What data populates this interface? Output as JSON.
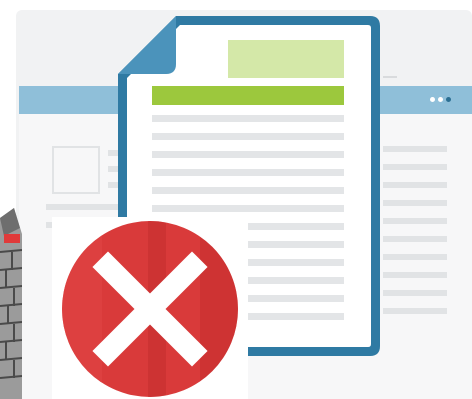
{
  "illustration": {
    "subject": "document-with-error",
    "icons": {
      "document": "document-icon",
      "error": "error-x-icon",
      "wall": "brick-wall-icon",
      "window_menu": "more-dots-icon"
    },
    "colors": {
      "window_background": "#f1f2f3",
      "title_bar": "#8fbfd9",
      "document_border": "#2f7aa3",
      "document_fold": "#4b93bb",
      "document_paper": "#ffffff",
      "document_lines": "#e3e5e7",
      "highlight_light_green": "#d4e8a8",
      "highlight_green": "#9cc83d",
      "error_red": "#d93a3a",
      "error_red_dark": "#c22d2d",
      "error_x": "#ffffff",
      "brick": "#8d8d8d",
      "brick_accent": "#e03a3a"
    }
  }
}
